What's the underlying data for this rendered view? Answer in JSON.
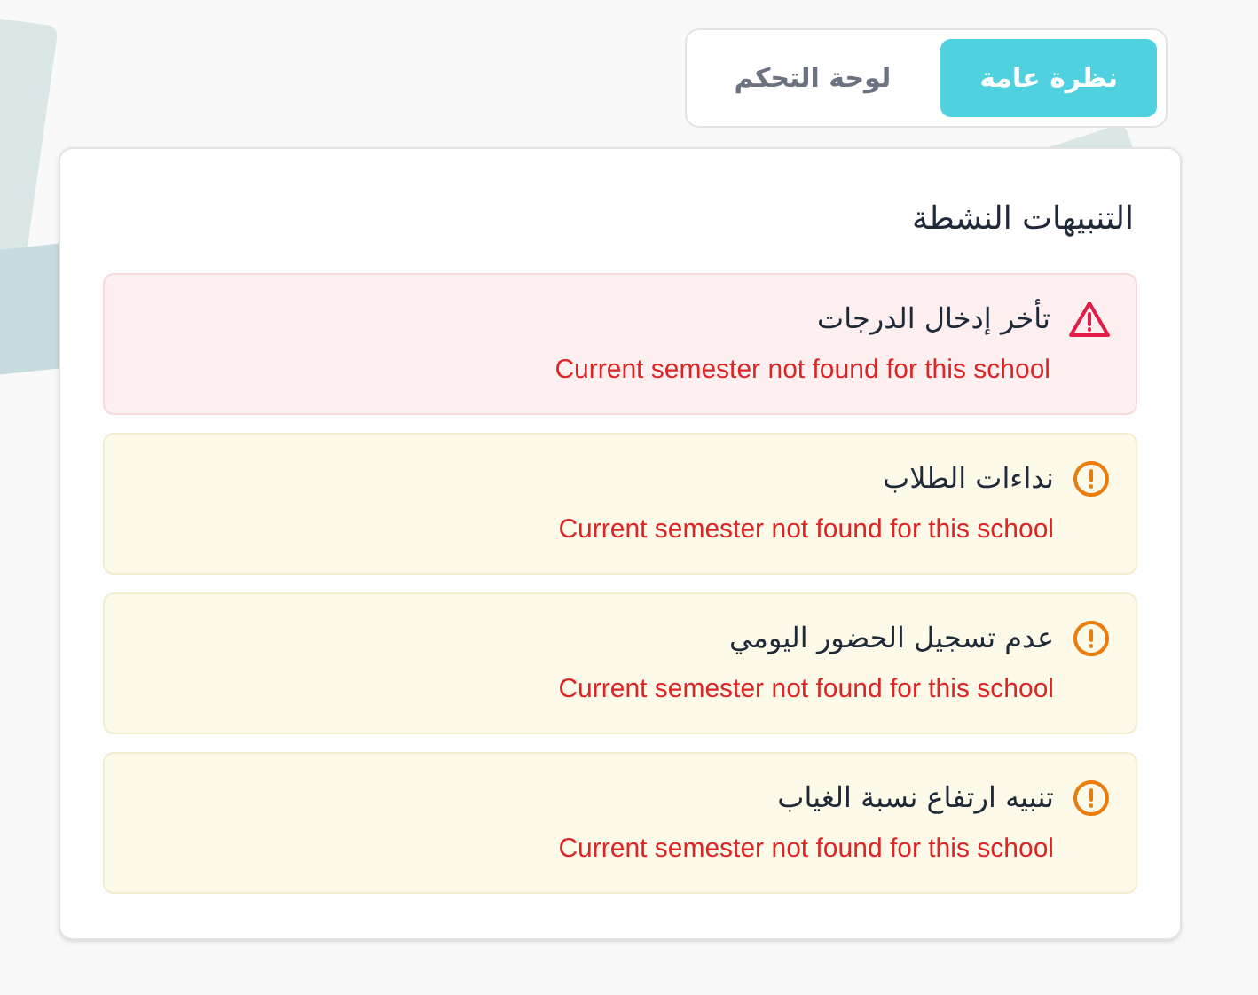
{
  "tabs": [
    {
      "label": "نظرة عامة",
      "selected": true
    },
    {
      "label": "لوحة التحكم",
      "selected": false
    }
  ],
  "panel": {
    "title": "التنبيهات النشطة",
    "alerts": [
      {
        "kind": "danger",
        "title": "تأخر إدخال الدرجات",
        "message": "Current semester not found for this school"
      },
      {
        "kind": "warning",
        "title": "نداءات الطلاب",
        "message": "Current semester not found for this school"
      },
      {
        "kind": "warning",
        "title": "عدم تسجيل الحضور اليومي",
        "message": "Current semester not found for this school"
      },
      {
        "kind": "warning",
        "title": "تنبيه ارتفاع نسبة الغياب",
        "message": "Current semester not found for this school"
      }
    ]
  }
}
